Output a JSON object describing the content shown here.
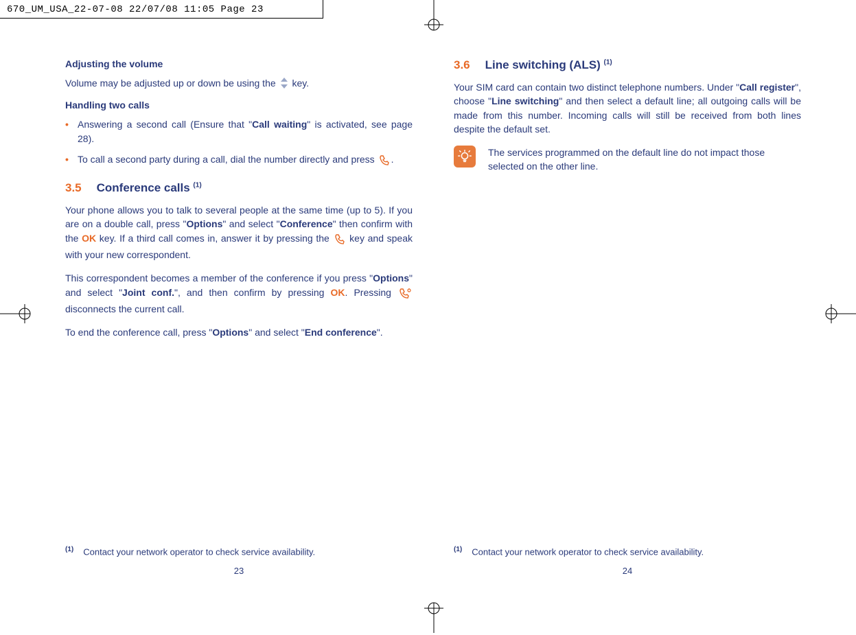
{
  "slug": "670_UM_USA_22-07-08  22/07/08  11:05  Page 23",
  "left": {
    "h_volume": "Adjusting the volume",
    "p_volume_a": "Volume may be adjusted up or down be using the ",
    "p_volume_b": " key.",
    "h_two_calls": "Handling two calls",
    "li1_a": "Answering a second call (Ensure that \"",
    "li1_b": "Call waiting",
    "li1_c": "\" is activated, see page 28).",
    "li2_a": "To call a second party during a call, dial the number directly and press ",
    "li2_b": ".",
    "sec35_num": "3.5",
    "sec35_title": "Conference calls ",
    "sec35_sup": "(1)",
    "p35a_1": "Your phone allows you to talk to several people at the same time (up to 5). If you are on a double call, press \"",
    "p35a_2": "Options",
    "p35a_3": "\" and select \"",
    "p35a_4": "Conference",
    "p35a_5": "\" then confirm with the ",
    "p35a_6": " key. If a third call comes in, answer it by pressing the ",
    "p35a_7": " key and speak with your new correspondent.",
    "p35b_1": "This correspondent becomes a member of the conference if you press \"",
    "p35b_2": "Options",
    "p35b_3": "\" and select \"",
    "p35b_4": "Joint conf.",
    "p35b_5": "\", and then confirm by pressing ",
    "p35b_6": ". Pressing ",
    "p35b_7": " disconnects the current call.",
    "p35c_1": "To end the conference call, press \"",
    "p35c_2": "Options",
    "p35c_3": "\" and select \"",
    "p35c_4": "End conference",
    "p35c_5": "\".",
    "footnote_sup": "(1)",
    "footnote": "Contact your network operator to check service availability.",
    "page_num": "23"
  },
  "right": {
    "sec36_num": "3.6",
    "sec36_title": "Line switching (ALS) ",
    "sec36_sup": "(1)",
    "p36_1": "Your SIM card can contain two distinct telephone numbers. Under \"",
    "p36_2": "Call register",
    "p36_3": "\", choose \"",
    "p36_4": "Line switching",
    "p36_5": "\" and then select a default line; all outgoing calls will be made from this number. Incoming calls will still be received from both lines despite the default set.",
    "tip": "The services programmed on the default line do not impact those selected on the other line.",
    "footnote_sup": "(1)",
    "footnote": "Contact your network operator to check service availability.",
    "page_num": "24"
  },
  "ok_label": "OK"
}
